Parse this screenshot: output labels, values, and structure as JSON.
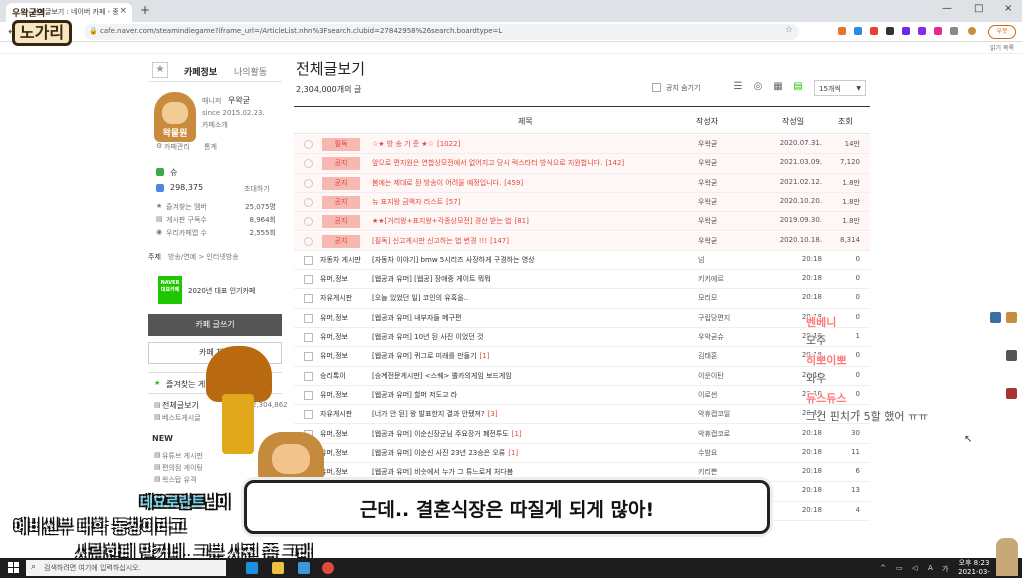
{
  "browser": {
    "tab_title": "전체글보기 : 네이버 카페 - 종합 게시판",
    "tab_close": "×",
    "new_tab": "+",
    "url": "cafe.naver.com/steamindiegame?iframe_url=/ArticleList.nhn%3Fsearch.clubid=27842958%26search.boardtype=L",
    "profile_label": "우뭇",
    "bookmarks_right": "읽기 목록",
    "controls": {
      "minimize": "—",
      "maximize": "□",
      "close": "×"
    }
  },
  "logo": {
    "top": "우왁굳의",
    "main": "노가리"
  },
  "cafe_sidebar": {
    "tab_cafe_info": "카페정보",
    "tab_my_activity": "나의활동",
    "star": "★",
    "manager_label": "매니저",
    "manager_name": "우왁굳",
    "since": "since 2015.02.23.",
    "cafe_intro": "카페소개",
    "avatar_text": "왁물원",
    "manage_link": "카페관리",
    "stats_link": "통계",
    "level": "슈",
    "members": "298,375",
    "invite": "초대하기",
    "stats": [
      {
        "label": "즐겨찾는 멤버",
        "value": "25,075명"
      },
      {
        "label": "게시판 구독수",
        "value": "8,964회"
      },
      {
        "label": "우리카페앱 수",
        "value": "2,555회"
      }
    ],
    "theme": "주제",
    "theme_value": "방송/연예 > 인터넷방송",
    "naver_badge": "NAVER 대표카페",
    "award": "2020년 대표 인기카페",
    "write_button": "카페 글쓰기",
    "chat_button": "카페 채팅",
    "fav_header": "즐겨찾는 게시판",
    "boards": [
      {
        "label": "전체글보기",
        "count": "2,304,862"
      },
      {
        "label": "베스트게시글",
        "count": ""
      }
    ],
    "new_label": "NEW",
    "new_boards": [
      "유튜브 게시판",
      "편의점 게이팅",
      "왁스탑 유격"
    ]
  },
  "main": {
    "title": "전체글보기",
    "post_count": "2,304,000개의 글",
    "notice_hide_label": "공지 숨기기",
    "per_page": "15개씩",
    "columns": {
      "subject": "제목",
      "author": "작성자",
      "date": "작성일",
      "views": "조회"
    },
    "notices": [
      {
        "badge": "필독",
        "subject": "☆★ 방 송 기 준 ★☆",
        "comments": "[1022]",
        "author": "우왁굳",
        "date": "2020.07.31.",
        "views": "14만"
      },
      {
        "badge": "공지",
        "subject": "앞으로 편지원은 연합상모전에서 없어지고 당시 럭스타터 방식으로 지원합니다.",
        "comments": "[142]",
        "author": "우왁굳",
        "date": "2021.03.09.",
        "views": "7,120"
      },
      {
        "badge": "공지",
        "subject": "봄에는 제대로 된 방송이 어려울 예정입니다.",
        "comments": "[459]",
        "author": "우왁굳",
        "date": "2021.02.12.",
        "views": "1.8만"
      },
      {
        "badge": "공지",
        "subject": "뉴 표지왕 금액자 리스트",
        "comments": "[57]",
        "author": "우왁굳",
        "date": "2020.10.20.",
        "views": "1.8만"
      },
      {
        "badge": "공지",
        "subject": "★★[거리왕+표지왕+각종상모전] 경산 받는 법",
        "comments": "[81]",
        "author": "우왁굳",
        "date": "2019.09.30.",
        "views": "1.8만"
      },
      {
        "badge": "공지",
        "subject": "[필독] 신고게시판 신고하는 법 변경 !!!",
        "comments": "[147]",
        "author": "우왁굳",
        "date": "2020.10.18.",
        "views": "8,314"
      }
    ],
    "posts": [
      {
        "board": "자동차 게시판",
        "subject": "[자동차 이야기] bmw 5시리즈 사장하게 구경하는 영상",
        "comments": "",
        "author": "넘",
        "date": "20:18",
        "views": "0"
      },
      {
        "board": "유머,정보",
        "subject": "[웹공과 유머] [웹공] 장애중 게이트 뭐뭐",
        "comments": "",
        "author": "키키에르",
        "date": "20:18",
        "views": "0"
      },
      {
        "board": "자유게시판",
        "subject": "[오늘 있었던 일] 코인의 유혹을..",
        "comments": "",
        "author": "모리모",
        "date": "20:18",
        "views": "0"
      },
      {
        "board": "유머,정보",
        "subject": "[웹공과 유머] 내부자들 메구편",
        "comments": "",
        "author": "구립당편지",
        "date": "20:18",
        "views": "0"
      },
      {
        "board": "유머,정보",
        "subject": "[웹공과 유머] 10년 된 사진 이었던 것",
        "comments": "",
        "author": "우악굳슈",
        "date": "20:18",
        "views": "1"
      },
      {
        "board": "유머,정보",
        "subject": "[웹공과 유머] 퀴그로 미래를 만들기",
        "comments": "[1]",
        "author": "김태훈",
        "date": "20:18",
        "views": "0"
      },
      {
        "board": "승리톡이",
        "subject": "[승계전문게시판] <스퀘> 뿔카의게임 보드게임",
        "comments": "",
        "author": "이운이탄",
        "date": "20:18",
        "views": "0"
      },
      {
        "board": "유머,정보",
        "subject": "[웹공과 유머] 할머 저도고 라",
        "comments": "",
        "author": "이로썬",
        "date": "20:18",
        "views": "0"
      },
      {
        "board": "자유게시판",
        "subject": "[너가 안 된] 왕 발표한지 결과 안됐져?",
        "comments": "[3]",
        "author": "악휴캡코일",
        "date": "20:18",
        "views": "0"
      },
      {
        "board": "유머,정보",
        "subject": "[웹공과 유머] 이순신장군님 주요장거 폐전투도",
        "comments": "[1]",
        "author": "악휴캡코로",
        "date": "20:18",
        "views": "30"
      },
      {
        "board": "유머,정보",
        "subject": "[웹공과 유머] 이순신 사진 23년 23승은 오류",
        "comments": "[1]",
        "author": "수밤요",
        "date": "20:18",
        "views": "11"
      },
      {
        "board": "유머,정보",
        "subject": "[웹공과 유머] 비슷에서 누가 그 튜느로게 처다봄",
        "comments": "",
        "author": "키리쁜",
        "date": "20:18",
        "views": "6"
      },
      {
        "board": "",
        "subject": "",
        "comments": "",
        "author": "",
        "date": "20:18",
        "views": "13"
      },
      {
        "board": "",
        "subject": "",
        "comments": "",
        "author": "",
        "date": "20:18",
        "views": "4"
      }
    ]
  },
  "stream_chat": [
    {
      "name": "벤베니",
      "msg": "모주"
    },
    {
      "name": "히뽀이뽀",
      "msg": "와우"
    },
    {
      "name": "듀스듀스",
      "msg": "그건 핀치가 5할 했어 ㅠㅠ"
    }
  ],
  "subtitles": {
    "box_text": "근데.. 결혼식장은 따질게 되게 많아!",
    "user_name": "데요로란트",
    "user_suffix": "님이",
    "line1": "예비신부 대학 동창이라고",
    "line2": "사람한테 말거네. 그분 사진 좀 그래"
  },
  "taskbar": {
    "search_placeholder": "검색하려면 여기에 입력하십시오.",
    "time": "오후 8:23",
    "date": "2021-03-16"
  },
  "colors": {
    "notice_red": "#e0493c",
    "badge_bg": "#f6b8b0",
    "chat_name": "#ff7a7a",
    "naver_green": "#1ec800"
  }
}
